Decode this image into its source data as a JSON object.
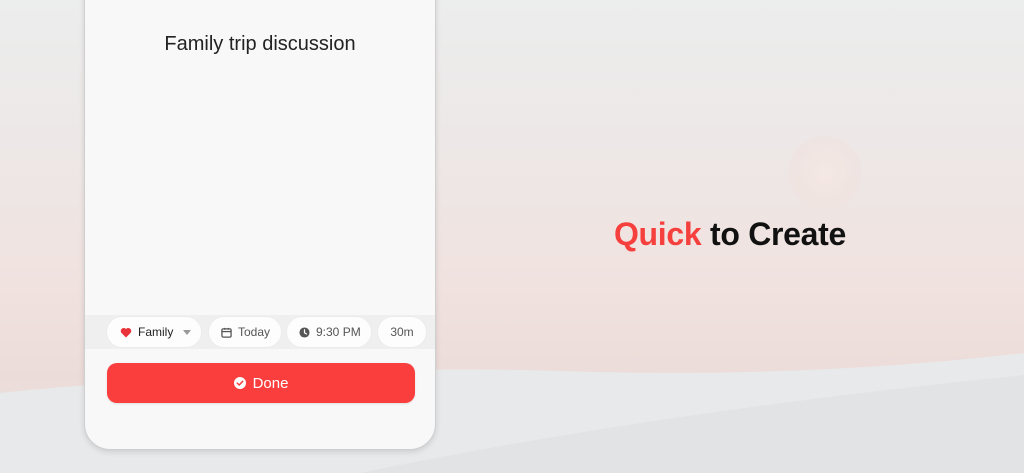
{
  "note": {
    "title": "Family trip discussion"
  },
  "chips": {
    "category": {
      "label": "Family",
      "icon": "heart-icon",
      "color": "#e8333a"
    },
    "date": {
      "label": "Today",
      "icon": "calendar-icon"
    },
    "time": {
      "label": "9:30 PM",
      "icon": "clock-icon"
    },
    "duration": {
      "label": "30m"
    }
  },
  "done_button": {
    "label": "Done",
    "icon": "check-circle-icon",
    "color": "#fa3e3e"
  },
  "headline": {
    "accent_word": "Quick",
    "rest": " to Create",
    "accent_color": "#f5403e"
  }
}
